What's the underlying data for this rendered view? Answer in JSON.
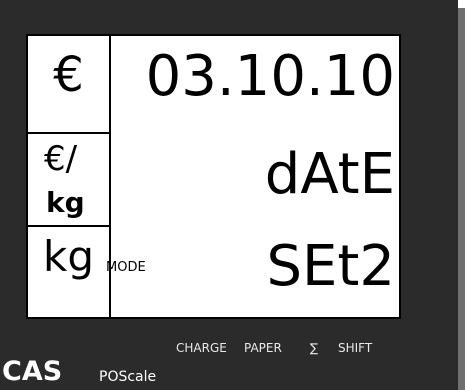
{
  "units": {
    "euro": "€",
    "euro_per_kg_line1": "€/",
    "euro_per_kg_line2": "kg",
    "kg": "kg"
  },
  "display": {
    "line1": "03.10.10",
    "line2": "dAtE",
    "line3": "SEt2",
    "mode_label": "MODE"
  },
  "keys": {
    "charge": "CHARGE",
    "paper": "PAPER",
    "sigma": "∑",
    "shift": "SHIFT"
  },
  "brand": {
    "name": "CAS",
    "product": "POScale"
  }
}
